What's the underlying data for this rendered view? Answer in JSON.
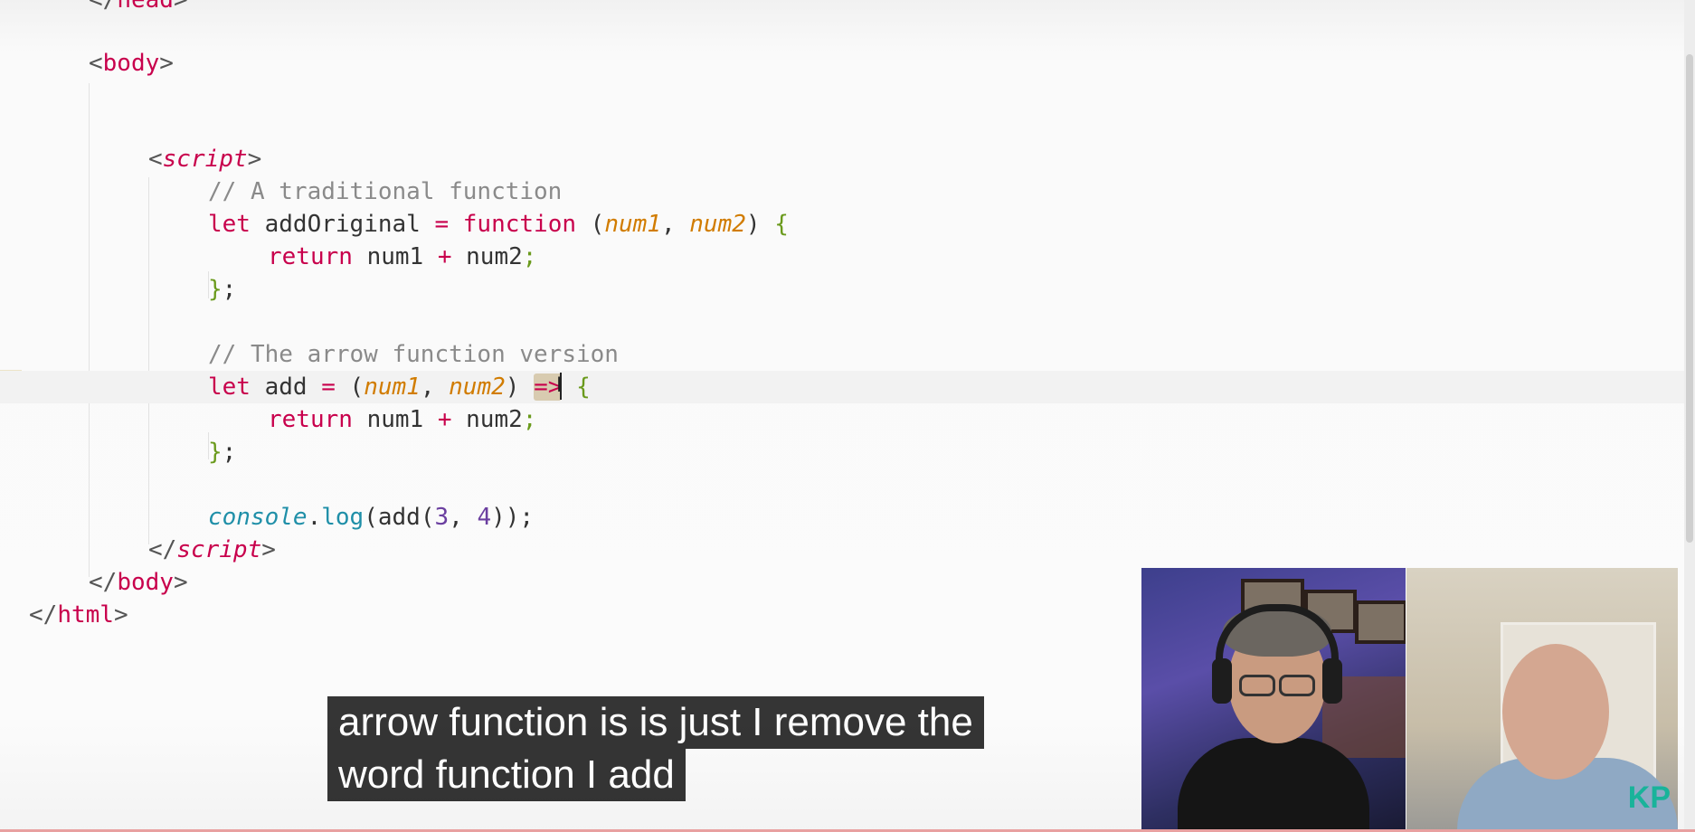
{
  "editor": {
    "lines": [
      {
        "id": "head-close",
        "tokens": [
          {
            "c": "t-punct",
            "t": "</"
          },
          {
            "c": "t-tag",
            "t": "head"
          },
          {
            "c": "t-punct",
            "t": ">"
          }
        ]
      },
      {
        "id": "body-open",
        "tokens": [
          {
            "c": "t-punct",
            "t": "<"
          },
          {
            "c": "t-tag",
            "t": "body"
          },
          {
            "c": "t-punct",
            "t": ">"
          }
        ]
      },
      {
        "id": "blank-1",
        "tokens": []
      },
      {
        "id": "script-open",
        "tokens": [
          {
            "c": "t-punct",
            "t": "<"
          },
          {
            "c": "t-tag",
            "t": "script",
            "i": true
          },
          {
            "c": "t-punct",
            "t": ">"
          }
        ]
      },
      {
        "id": "comment-traditional",
        "tokens": [
          {
            "c": "t-comment",
            "t": "// A traditional function"
          }
        ]
      },
      {
        "id": "let-addoriginal",
        "tokens": [
          {
            "c": "t-kw",
            "t": "let"
          },
          {
            "c": "t-plain",
            "t": " addOriginal "
          },
          {
            "c": "t-kw",
            "t": "="
          },
          {
            "c": "t-plain",
            "t": " "
          },
          {
            "c": "t-fn",
            "t": "function"
          },
          {
            "c": "t-plain",
            "t": " ("
          },
          {
            "c": "t-param",
            "t": "num1"
          },
          {
            "c": "t-plain",
            "t": ", "
          },
          {
            "c": "t-param",
            "t": "num2"
          },
          {
            "c": "t-plain",
            "t": ") "
          },
          {
            "c": "t-brace",
            "t": "{"
          }
        ]
      },
      {
        "id": "return-1",
        "tokens": [
          {
            "c": "t-kw",
            "t": "return"
          },
          {
            "c": "t-plain",
            "t": " num1 "
          },
          {
            "c": "t-kw",
            "t": "+"
          },
          {
            "c": "t-plain",
            "t": " num2"
          },
          {
            "c": "t-semi",
            "t": ";"
          }
        ]
      },
      {
        "id": "close-1",
        "tokens": [
          {
            "c": "t-brace",
            "t": "}"
          },
          {
            "c": "t-plain",
            "t": ";"
          }
        ]
      },
      {
        "id": "blank-2",
        "tokens": []
      },
      {
        "id": "comment-arrow",
        "tokens": [
          {
            "c": "t-comment",
            "t": "// The arrow function version"
          }
        ]
      },
      {
        "id": "let-add",
        "tokens": [
          {
            "c": "t-kw",
            "t": "let"
          },
          {
            "c": "t-plain",
            "t": " add "
          },
          {
            "c": "t-kw",
            "t": "="
          },
          {
            "c": "t-plain",
            "t": " ("
          },
          {
            "c": "t-param",
            "t": "num1"
          },
          {
            "c": "t-plain",
            "t": ", "
          },
          {
            "c": "t-param",
            "t": "num2"
          },
          {
            "c": "t-plain",
            "t": ") "
          },
          {
            "c": "t-arrow",
            "t": "=>"
          },
          {
            "c": "t-plain",
            "t": " "
          },
          {
            "c": "t-brace",
            "t": "{"
          }
        ]
      },
      {
        "id": "return-2",
        "tokens": [
          {
            "c": "t-kw",
            "t": "return"
          },
          {
            "c": "t-plain",
            "t": " num1 "
          },
          {
            "c": "t-kw",
            "t": "+"
          },
          {
            "c": "t-plain",
            "t": " num2"
          },
          {
            "c": "t-semi",
            "t": ";"
          }
        ]
      },
      {
        "id": "close-2",
        "tokens": [
          {
            "c": "t-brace",
            "t": "}"
          },
          {
            "c": "t-plain",
            "t": ";"
          }
        ]
      },
      {
        "id": "blank-3",
        "tokens": []
      },
      {
        "id": "console-log",
        "tokens": [
          {
            "c": "t-obj",
            "t": "console"
          },
          {
            "c": "t-plain",
            "t": "."
          },
          {
            "c": "t-method",
            "t": "log"
          },
          {
            "c": "t-plain",
            "t": "(add("
          },
          {
            "c": "t-num",
            "t": "3"
          },
          {
            "c": "t-plain",
            "t": ", "
          },
          {
            "c": "t-num",
            "t": "4"
          },
          {
            "c": "t-plain",
            "t": "));"
          }
        ]
      },
      {
        "id": "script-close",
        "tokens": [
          {
            "c": "t-punct",
            "t": "</"
          },
          {
            "c": "t-tag",
            "t": "script",
            "i": true
          },
          {
            "c": "t-punct",
            "t": ">"
          }
        ]
      },
      {
        "id": "body-close",
        "tokens": [
          {
            "c": "t-punct",
            "t": "</"
          },
          {
            "c": "t-tag",
            "t": "body"
          },
          {
            "c": "t-punct",
            "t": ">"
          }
        ]
      },
      {
        "id": "html-close",
        "tokens": [
          {
            "c": "t-punct",
            "t": "</"
          },
          {
            "c": "t-tag",
            "t": "html"
          },
          {
            "c": "t-punct",
            "t": ">"
          }
        ]
      }
    ]
  },
  "caption": {
    "line1": "arrow function is is just I remove the",
    "line2": "word function I add"
  },
  "webcam": {
    "logo": "KP",
    "left_label": "host-webcam",
    "right_label": "guest-webcam"
  },
  "colors": {
    "tag": "#c8004c",
    "param": "#d17c00",
    "comment": "#8a8a8a",
    "brace": "#6a9a1c",
    "method": "#1f8fa8",
    "number": "#6b3fa0"
  }
}
